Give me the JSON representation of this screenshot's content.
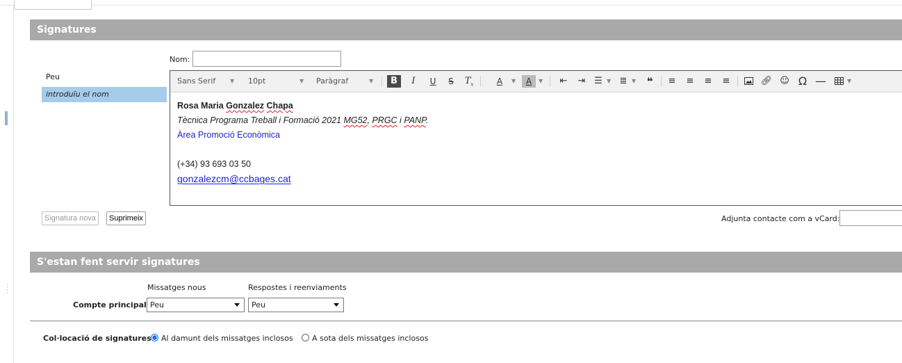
{
  "signatures_section": {
    "title": "Signatures",
    "name_label": "Nom:",
    "name_value": "",
    "list": [
      {
        "label": "Peu",
        "selected": false
      },
      {
        "label": "introduïu el nom",
        "selected": true
      }
    ],
    "toolbar": {
      "font_family": "Sans Serif",
      "font_size": "10pt",
      "block_format": "Paràgraf",
      "icons": [
        "bold-icon",
        "italic-icon",
        "underline-icon",
        "strikethrough-icon",
        "clear-format-icon",
        "text-color-icon",
        "background-color-icon",
        "outdent-icon",
        "indent-icon",
        "bullet-list-icon",
        "numbered-list-icon",
        "blockquote-icon",
        "align-left-icon",
        "align-center-icon",
        "align-right-icon",
        "justify-icon",
        "image-icon",
        "link-icon",
        "emoticon-icon",
        "special-char-icon",
        "horizontal-rule-icon",
        "table-icon"
      ]
    },
    "signature": {
      "name": "Rosa Maria Gonzalez Chapa",
      "role": "Tècnica Programa Treball i Formació 2021 MG52, PRGC i PANP.",
      "department": "Àrea Promoció Econòmica",
      "phone": "(+34) 93 693 03 50",
      "email": "gonzalezcm@ccbages.cat",
      "department_color": "#2222cc",
      "email_color": "#1a1aee"
    },
    "new_button": "Signatura nova",
    "delete_button": "Suprimeix",
    "vcard_label": "Adjunta contacte com a vCard:",
    "vcard_value": ""
  },
  "usage_section": {
    "title": "S'estan fent servir signatures",
    "col_new": "Missatges nous",
    "col_replies": "Respostes i reenviaments",
    "account_label": "Compte principal:",
    "new_value": "Peu",
    "replies_value": "Peu",
    "placement_label": "Col·locació de signatures:",
    "placement_above": "Al damunt dels missatges inclosos",
    "placement_below": "A sota dels missatges inclosos",
    "placement_selected": "above"
  },
  "colors": {
    "section_header_bg": "#a9a9a9",
    "selected_item_bg": "#a7cbea",
    "radio_accent": "#1a73e8"
  }
}
